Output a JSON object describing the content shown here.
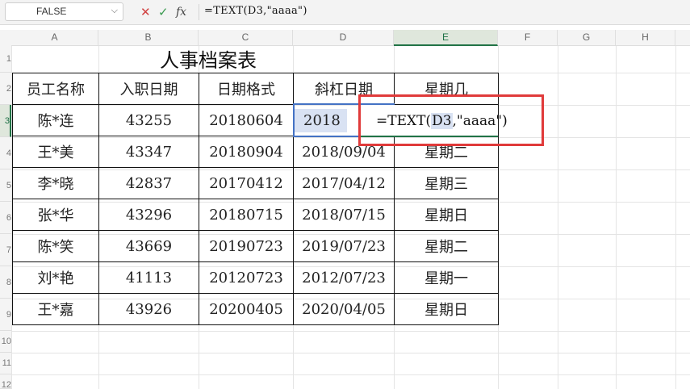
{
  "formula_bar": {
    "name_box": "FALSE",
    "cancel_icon": "✕",
    "enter_icon": "✓",
    "fx_icon": "fx",
    "formula": "=TEXT(D3,\"aaaa\")"
  },
  "columns": [
    "A",
    "B",
    "C",
    "D",
    "E",
    "F",
    "G",
    "H"
  ],
  "rows": [
    "1",
    "2",
    "3",
    "4",
    "5",
    "6",
    "7",
    "8",
    "9",
    "10",
    "11",
    "12"
  ],
  "title": "人事档案表",
  "headers": [
    "员工名称",
    "入职日期",
    "日期格式",
    "斜杠日期",
    "星期几"
  ],
  "records": [
    [
      "陈*连",
      "43255",
      "20180604",
      "2018",
      ""
    ],
    [
      "王*美",
      "43347",
      "20180904",
      "2018/09/04",
      "星期二"
    ],
    [
      "李*晓",
      "42837",
      "20170412",
      "2017/04/12",
      "星期三"
    ],
    [
      "张*华",
      "43296",
      "20180715",
      "2018/07/15",
      "星期日"
    ],
    [
      "陈*笑",
      "43669",
      "20190723",
      "2019/07/23",
      "星期二"
    ],
    [
      "刘*艳",
      "41113",
      "20120723",
      "2012/07/23",
      "星期一"
    ],
    [
      "王*嘉",
      "43926",
      "20200405",
      "2020/04/05",
      "星期日"
    ]
  ],
  "editing": {
    "prefix": "=TEXT(",
    "ref": "D3",
    "suffix": ",\"aaaa\")"
  },
  "colors": {
    "highlight_red": "#e03a3a",
    "selection_blue": "#4472c4",
    "excel_green": "#217346"
  }
}
